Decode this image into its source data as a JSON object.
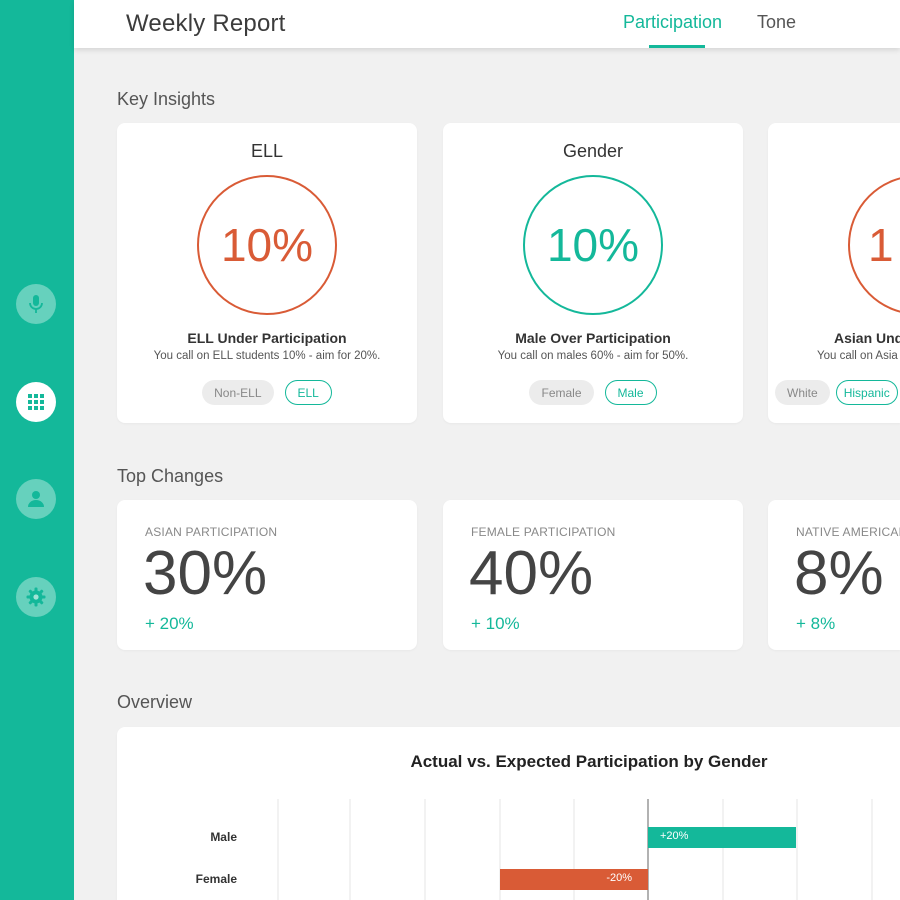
{
  "header": {
    "title": "Weekly Report",
    "tabs": [
      {
        "label": "Participation",
        "active": true
      },
      {
        "label": "Tone",
        "active": false
      }
    ]
  },
  "sidebar": {
    "items": [
      {
        "icon": "microphone-icon",
        "active": false
      },
      {
        "icon": "grid-icon",
        "active": true
      },
      {
        "icon": "person-icon",
        "active": false
      },
      {
        "icon": "gear-icon",
        "active": false
      }
    ]
  },
  "colors": {
    "accent": "#14b89a",
    "warning": "#d95b36"
  },
  "key_insights": {
    "title": "Key Insights",
    "cards": [
      {
        "title": "ELL",
        "value": "10%",
        "status": "under",
        "heading": "ELL Under Participation",
        "description": "You call on ELL students 10% - aim for 20%.",
        "pills": [
          {
            "label": "Non-ELL",
            "selected": false
          },
          {
            "label": "ELL",
            "selected": true
          }
        ]
      },
      {
        "title": "Gender",
        "value": "10%",
        "status": "over",
        "heading": "Male Over Participation",
        "description": "You call on males 60% - aim for 50%.",
        "pills": [
          {
            "label": "Female",
            "selected": false
          },
          {
            "label": "Male",
            "selected": true
          }
        ]
      },
      {
        "title": "",
        "value": "1",
        "status": "under",
        "heading": "Asian Und",
        "description": "You call on Asia",
        "pills": [
          {
            "label": "White",
            "selected": false
          },
          {
            "label": "Hispanic",
            "selected": true
          }
        ]
      }
    ]
  },
  "top_changes": {
    "title": "Top Changes",
    "cards": [
      {
        "label": "ASIAN PARTICIPATION",
        "value": "30%",
        "delta": "+ 20%"
      },
      {
        "label": "FEMALE PARTICIPATION",
        "value": "40%",
        "delta": "+ 10%"
      },
      {
        "label": "NATIVE AMERICAN",
        "value": "8%",
        "delta": "+ 8%"
      }
    ]
  },
  "overview": {
    "title": "Overview"
  },
  "chart_data": {
    "type": "bar",
    "orientation": "horizontal",
    "title": "Actual vs. Expected Participation by Gender",
    "categories": [
      "Male",
      "Female"
    ],
    "values": [
      20,
      -20
    ],
    "value_labels": [
      "+20%",
      "-20%"
    ],
    "xlim": [
      -50,
      30
    ],
    "grid": true,
    "colors": {
      "positive": "#14b89a",
      "negative": "#d95b36"
    }
  }
}
